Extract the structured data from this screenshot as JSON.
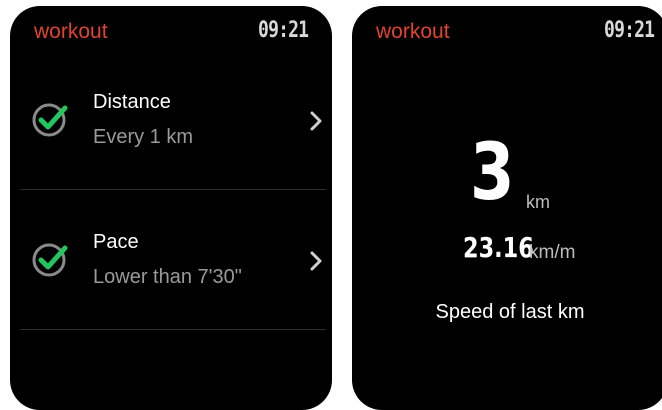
{
  "colors": {
    "accent": "#e0442e",
    "check_green": "#22c55e",
    "background": "#000000"
  },
  "left_screen": {
    "app_title": "workout",
    "time": "09:21",
    "items": [
      {
        "title": "Distance",
        "subtitle": "Every 1 km",
        "checked": true,
        "icon": "check-circle-icon"
      },
      {
        "title": "Pace",
        "subtitle": "Lower than 7'30\"",
        "checked": true,
        "icon": "check-circle-icon"
      }
    ]
  },
  "right_screen": {
    "app_title": "workout",
    "time": "09:21",
    "distance_value": "3",
    "distance_unit": "km",
    "speed_value": "23.16",
    "speed_unit": "km/m",
    "caption": "Speed of last km"
  }
}
